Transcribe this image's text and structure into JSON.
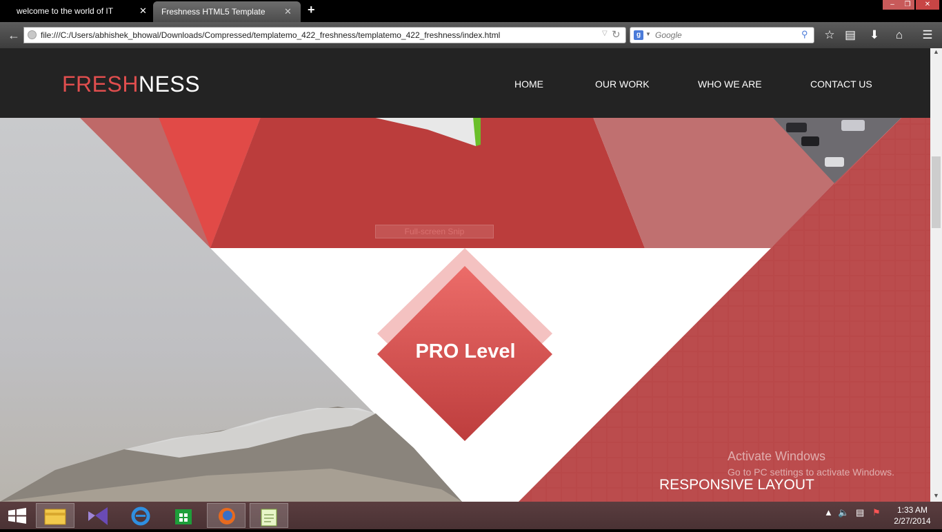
{
  "browser": {
    "tabs": [
      {
        "title": "welcome to the world of IT",
        "active": false
      },
      {
        "title": "Freshness HTML5 Template",
        "active": true
      }
    ],
    "new_tab": "+",
    "close_glyph": "✕",
    "url": "file:///C:/Users/abhishek_bhowal/Downloads/Compressed/templatemo_422_freshness/templatemo_422_freshness/index.html",
    "search_placeholder": "Google",
    "window_controls": {
      "minimize": "–",
      "maximize": "❐",
      "close": "✕"
    }
  },
  "site": {
    "logo": {
      "part1": "FRESH",
      "part2": "NESS"
    },
    "menu": [
      "HOME",
      "OUR WORK",
      "WHO WE ARE",
      "CONTACT US"
    ],
    "hero": {
      "snip_text": "Full-screen Snip",
      "pro_label": "PRO Level",
      "responsive_label": "RESPONSIVE LAYOUT"
    }
  },
  "watermark": {
    "line1": "Activate Windows",
    "line2": "Go to PC settings to activate Windows."
  },
  "taskbar": {
    "apps": [
      "start-icon",
      "file-explorer-icon",
      "visual-studio-icon",
      "internet-explorer-icon",
      "store-icon",
      "firefox-icon",
      "notepad-icon"
    ],
    "clock": {
      "time": "1:33 AM",
      "date": "2/27/2014"
    }
  },
  "colors": {
    "accent": "#e04e4e",
    "header_bg": "#232323",
    "red_main": "#c0403f",
    "red_panel": "#b84a4c"
  }
}
